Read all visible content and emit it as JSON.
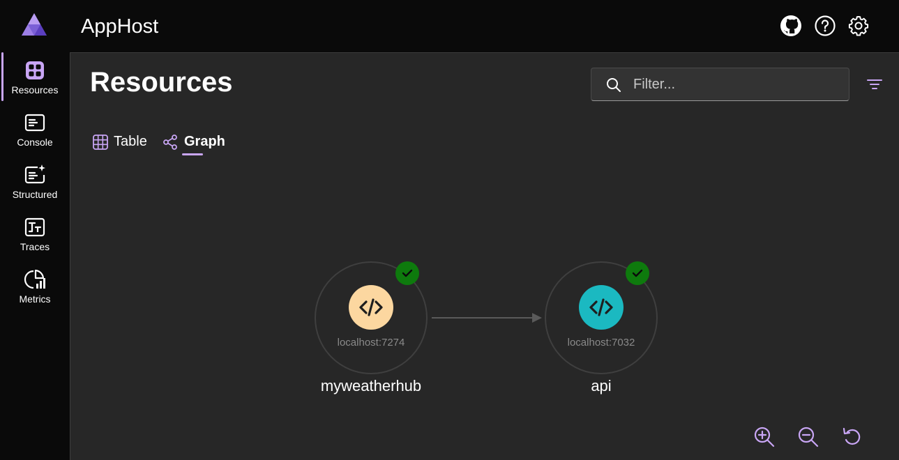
{
  "header": {
    "app_title": "AppHost",
    "icons": [
      "github-icon",
      "help-icon",
      "settings-icon"
    ]
  },
  "sidebar": {
    "items": [
      {
        "label": "Resources",
        "icon": "resources-icon",
        "active": true
      },
      {
        "label": "Console",
        "icon": "console-icon"
      },
      {
        "label": "Structured",
        "icon": "structured-icon"
      },
      {
        "label": "Traces",
        "icon": "traces-icon"
      },
      {
        "label": "Metrics",
        "icon": "metrics-icon"
      }
    ]
  },
  "main": {
    "title": "Resources",
    "filter": {
      "placeholder": "Filter...",
      "value": ""
    },
    "tabs": [
      {
        "label": "Table",
        "icon": "table-icon",
        "active": false
      },
      {
        "label": "Graph",
        "icon": "graph-icon",
        "active": true
      }
    ],
    "graph": {
      "nodes": [
        {
          "name": "myweatherhub",
          "endpoint": "localhost:7274",
          "status": "running",
          "color": "#fcd7a0"
        },
        {
          "name": "api",
          "endpoint": "localhost:7032",
          "status": "running",
          "color": "#1bb9c1"
        }
      ],
      "edges": [
        {
          "from": "myweatherhub",
          "to": "api"
        }
      ]
    },
    "zoom_controls": [
      "zoom-in-icon",
      "zoom-out-icon",
      "reset-view-icon"
    ]
  },
  "colors": {
    "accent": "#c9a6f5",
    "success": "#0e7a0d",
    "background": "#272727",
    "chrome": "#0a0a0a"
  }
}
